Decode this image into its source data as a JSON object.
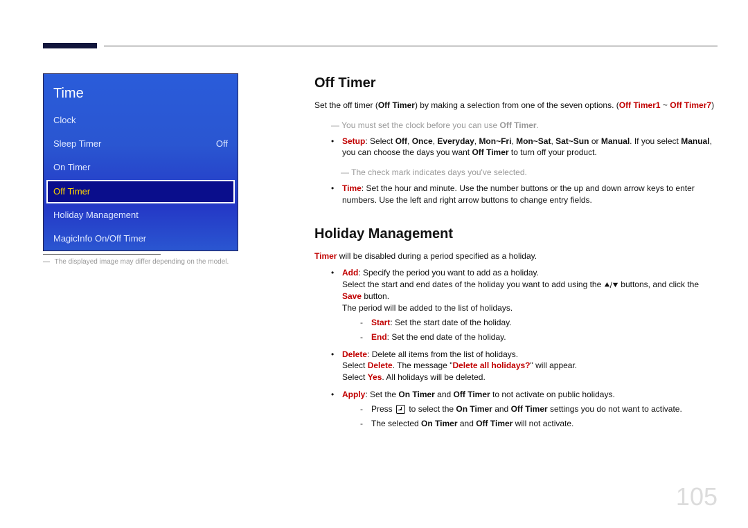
{
  "page_number": "105",
  "sidebar": {
    "title": "Time",
    "items": [
      {
        "label": "Clock",
        "value": "",
        "active": false
      },
      {
        "label": "Sleep Timer",
        "value": "Off",
        "active": false
      },
      {
        "label": "On Timer",
        "value": "",
        "active": false
      },
      {
        "label": "Off Timer",
        "value": "",
        "active": true
      },
      {
        "label": "Holiday Management",
        "value": "",
        "active": false
      },
      {
        "label": "MagicInfo On/Off Timer",
        "value": "",
        "active": false
      }
    ]
  },
  "left_caption": {
    "prefix": "―",
    "text": "The displayed image may differ depending on the model."
  },
  "content": {
    "offtimer": {
      "heading": "Off Timer",
      "intro": {
        "pre": "Set the off timer (",
        "b1": "Off Timer",
        "mid": ") by making a selection from one of the seven options. (",
        "r1": "Off Timer1",
        "tilde": " ~ ",
        "r2": "Off Timer7",
        "post": ")"
      },
      "note1": {
        "pre": "― You must set the clock before you can use ",
        "b": "Off Timer",
        "post": "."
      },
      "setup": {
        "lead": "Setup",
        "colon": ": Select ",
        "opts": [
          "Off",
          "Once",
          "Everyday",
          "Mon~Fri",
          "Mon~Sat",
          "Sat~Sun",
          "Manual"
        ],
        "sep": ", ",
        "or": " or ",
        "after_opts": ". If you select ",
        "manual": "Manual",
        "after_manual1": ", you can choose the days you want ",
        "b_inline": "Off Timer",
        "after_manual2": " to turn off your product."
      },
      "note2": "― The check mark indicates days you've selected.",
      "time_bullet": {
        "lead": "Time",
        "text": ": Set the hour and minute. Use the number buttons or the up and down arrow keys to enter numbers. Use the left and right arrow buttons to change entry fields."
      }
    },
    "holiday": {
      "heading": "Holiday Management",
      "intro": {
        "r": "Timer",
        "text": " will be disabled during a period specified as a holiday."
      },
      "add": {
        "lead": "Add",
        "text": ": Specify the period you want to add as a holiday.",
        "line2_pre": "Select the start and end dates of the holiday you want to add using the ",
        "line2_post": " buttons, and click the ",
        "save": "Save",
        "line2_end": " button.",
        "line3": "The period will be added to the list of holidays."
      },
      "start": {
        "lead": "Start",
        "text": ": Set the start date of the holiday."
      },
      "end": {
        "lead": "End",
        "text": ": Set the end date of the holiday."
      },
      "delete": {
        "lead": "Delete",
        "text": ": Delete all items from the list of holidays.",
        "l2_pre": "Select ",
        "l2_r1": "Delete",
        "l2_mid": ". The message \"",
        "l2_r2": "Delete all holidays?",
        "l2_post": "\" will appear.",
        "l3_pre": "Select ",
        "l3_r": "Yes",
        "l3_post": ". All holidays will be deleted."
      },
      "apply": {
        "lead": "Apply",
        "text_pre": ": Set the ",
        "on": "On Timer",
        "and": " and ",
        "off": "Off Timer",
        "text_post": " to not activate on public holidays.",
        "sub1_pre": "Press ",
        "sub1_mid": " to select the ",
        "sub1_post": " settings you do not want to activate.",
        "sub2_pre": "The selected ",
        "sub2_post": " will not activate."
      }
    }
  }
}
